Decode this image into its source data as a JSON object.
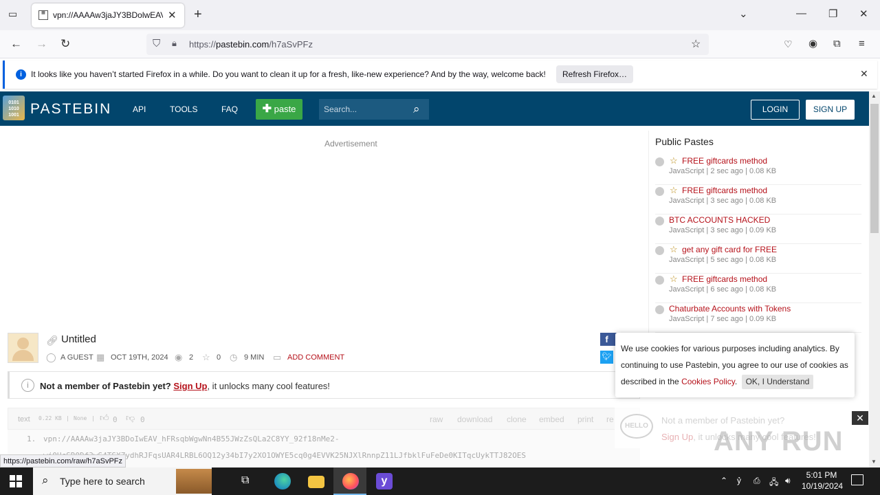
{
  "browser": {
    "tab_title": "vpn://AAAAw3jaJY3BDolwEAV",
    "tab_favicon_text": "001 110 011",
    "url_prefix": "https://",
    "url_host": "pastebin.com",
    "url_path": "/h7aSvPFz",
    "notification_text": "It looks like you haven’t started Firefox in a while. Do you want to clean it up for a fresh, like-new experience? And by the way, welcome back!",
    "notification_button": "Refresh Firefox…",
    "status_url": "https://pastebin.com/raw/h7aSvPFz"
  },
  "site": {
    "brand": "PASTEBIN",
    "logo_text": "0101 1010 1001",
    "nav": [
      "API",
      "TOOLS",
      "FAQ"
    ],
    "paste_label": "paste",
    "search_placeholder": "Search...",
    "login": "LOGIN",
    "signup": "SIGN UP",
    "advertisement": "Advertisement"
  },
  "sidebar": {
    "heading": "Public Pastes",
    "items": [
      {
        "title": "FREE giftcards method",
        "meta": "JavaScript | 2 sec ago | 0.08 KB",
        "starred": true
      },
      {
        "title": "FREE giftcards method",
        "meta": "JavaScript | 3 sec ago | 0.08 KB",
        "starred": true
      },
      {
        "title": "BTC ACCOUNTS HACKED",
        "meta": "JavaScript | 3 sec ago | 0.09 KB",
        "starred": false
      },
      {
        "title": "get any gift card for FREE",
        "meta": "JavaScript | 5 sec ago | 0.08 KB",
        "starred": true
      },
      {
        "title": "FREE giftcards method",
        "meta": "JavaScript | 6 sec ago | 0.08 KB",
        "starred": true
      },
      {
        "title": "Chaturbate Accounts with Tokens",
        "meta": "JavaScript | 7 sec ago | 0.09 KB",
        "starred": false
      }
    ]
  },
  "paste": {
    "title": "Untitled",
    "author": "A GUEST",
    "date": "OCT 19TH, 2024",
    "views": "2",
    "stars": "0",
    "expire": "9 MIN",
    "add_comment": "ADD COMMENT",
    "banner_lead": "Not a member of Pastebin yet?",
    "banner_link": "Sign Up",
    "banner_tail": ", it unlocks many cool features!",
    "syntax": "text",
    "size": "0.22 KB",
    "category": "None",
    "likes": "0",
    "dislikes": "0",
    "actions": [
      "raw",
      "download",
      "clone",
      "embed",
      "print",
      "re"
    ],
    "line_number": "1.",
    "code_line1": "vpn://AAAAw3jaJY3BDoIwEAV_hFRsqbWgwNn4B55JWzZsQLa2C8YY_92f18nMe2-",
    "code_line2": "wj0HcSR0Df3wS4TSXZydhRJFqsUAR4LRBL6OQ12y34bI7y2XO1OWYE5cq0g4EVVK25NJXlRnnpZ11LJfbklFuFeDe0KITqcUykTTJ82OES"
  },
  "cookie": {
    "text": "We use cookies for various purposes including analytics. By continuing to use Pastebin, you agree to our use of cookies as described in the",
    "link": "Cookies Policy",
    "period": ".",
    "ok": "OK, I Understand"
  },
  "signup_popup": {
    "hello": "HELLO",
    "line1": "Not a member of Pastebin yet?",
    "link": "Sign Up",
    "line2": ", it unlocks many cool features!"
  },
  "watermark": "ANY RUN",
  "taskbar": {
    "search_placeholder": "Type here to search",
    "time": "5:01 PM",
    "date": "10/19/2024"
  }
}
